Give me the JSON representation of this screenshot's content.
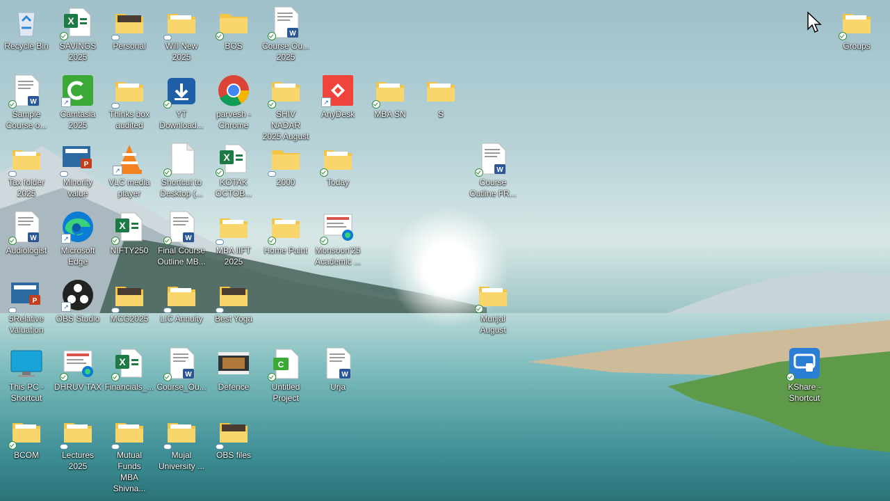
{
  "desktop": {
    "icons": [
      {
        "label": "Recycle Bin",
        "type": "recycle",
        "overlay": "none"
      },
      {
        "label": "SAVINGS\n2025",
        "type": "excel",
        "overlay": "sync"
      },
      {
        "label": "Personal",
        "type": "folder-dark",
        "overlay": "cloud"
      },
      {
        "label": "Will New\n2025",
        "type": "folder",
        "overlay": "cloud"
      },
      {
        "label": "BOS",
        "type": "folder-plain",
        "overlay": "sync"
      },
      {
        "label": "Course Ou...\n2025",
        "type": "word",
        "overlay": "sync"
      },
      {
        "label": "Groups",
        "type": "folder",
        "overlay": "sync"
      },
      {
        "label": "Sample\nCourse o...",
        "type": "word",
        "overlay": "sync"
      },
      {
        "label": "Camtasia\n2025",
        "type": "camtasia",
        "overlay": "shortcut"
      },
      {
        "label": "Thinks box\naudited",
        "type": "folder",
        "overlay": "cloud"
      },
      {
        "label": "YT\nDownload...",
        "type": "download",
        "overlay": "sync"
      },
      {
        "label": "parvesh -\nChrome",
        "type": "chrome",
        "overlay": "none"
      },
      {
        "label": "SHIV NADAR\n2025 August",
        "type": "folder",
        "overlay": "sync"
      },
      {
        "label": "AnyDesk",
        "type": "anydesk",
        "overlay": "shortcut"
      },
      {
        "label": "MBA SN",
        "type": "folder",
        "overlay": "sync"
      },
      {
        "label": "S",
        "type": "folder",
        "overlay": "none"
      },
      {
        "label": "Tax folder\n2025",
        "type": "folder",
        "overlay": "cloud"
      },
      {
        "label": "Minority\nvalue",
        "type": "ppt",
        "overlay": "cloud"
      },
      {
        "label": "VLC media\nplayer",
        "type": "vlc",
        "overlay": "shortcut"
      },
      {
        "label": "Shortcut to\nDesktop (...",
        "type": "blank",
        "overlay": "sync"
      },
      {
        "label": "KOTAK\nOCTOB...",
        "type": "excel",
        "overlay": "sync"
      },
      {
        "label": "2000",
        "type": "folder-plain",
        "overlay": "cloud"
      },
      {
        "label": "Today",
        "type": "folder",
        "overlay": "sync"
      },
      {
        "label": "Course\nOutline FR...",
        "type": "word",
        "overlay": "sync"
      },
      {
        "label": "Audiologist",
        "type": "word",
        "overlay": "sync"
      },
      {
        "label": "Microsoft\nEdge",
        "type": "edge",
        "overlay": "shortcut"
      },
      {
        "label": "NIFTY250",
        "type": "excel",
        "overlay": "sync"
      },
      {
        "label": "Final Course\nOutline MB...",
        "type": "word",
        "overlay": "sync"
      },
      {
        "label": "MBA IIFT\n2025",
        "type": "folder",
        "overlay": "cloud"
      },
      {
        "label": "Home Paint",
        "type": "folder",
        "overlay": "sync"
      },
      {
        "label": "Monsoon'25\nAcademic ...",
        "type": "edge-doc",
        "overlay": "sync"
      },
      {
        "label": "5Relative\nValuation",
        "type": "ppt",
        "overlay": "cloud"
      },
      {
        "label": "OBS Studio",
        "type": "obs",
        "overlay": "shortcut"
      },
      {
        "label": "MCG2025",
        "type": "folder-dark",
        "overlay": "cloud"
      },
      {
        "label": "LIC Annuity",
        "type": "folder",
        "overlay": "cloud"
      },
      {
        "label": "Best Yoga",
        "type": "folder-dark",
        "overlay": "cloud"
      },
      {
        "label": "Munjal\nAugust",
        "type": "folder",
        "overlay": "sync"
      },
      {
        "label": "This PC -\nShortcut",
        "type": "monitor",
        "overlay": "none"
      },
      {
        "label": "DHRUV TAX",
        "type": "edge-doc",
        "overlay": "sync"
      },
      {
        "label": "Financials_...",
        "type": "excel",
        "overlay": "sync"
      },
      {
        "label": "Course_Ou...",
        "type": "word",
        "overlay": "sync"
      },
      {
        "label": "Defence",
        "type": "video",
        "overlay": "none"
      },
      {
        "label": "Untitled\nProject",
        "type": "camproj",
        "overlay": "sync"
      },
      {
        "label": "Urja",
        "type": "word",
        "overlay": "none"
      },
      {
        "label": "KShare -\nShortcut",
        "type": "kshare",
        "overlay": "sync"
      },
      {
        "label": "BCOM",
        "type": "folder",
        "overlay": "sync"
      },
      {
        "label": "Lectures\n2025",
        "type": "folder",
        "overlay": "cloud"
      },
      {
        "label": "Mutual Funds\nMBA Shivna...",
        "type": "folder",
        "overlay": "cloud"
      },
      {
        "label": "Mujal\nUniversity ...",
        "type": "folder",
        "overlay": "cloud"
      },
      {
        "label": "OBS files",
        "type": "folder-dark",
        "overlay": "cloud"
      }
    ]
  },
  "colors": {
    "folder": "#f4c542",
    "folder_front": "#f8d66b",
    "excel": "#1d7a45",
    "word": "#2b5797",
    "ppt": "#c43e1c",
    "anydesk": "#ef443b",
    "camtasia": "#3aa935",
    "yt_download": "#1f5fa8",
    "kshare": "#2a7fd4"
  }
}
